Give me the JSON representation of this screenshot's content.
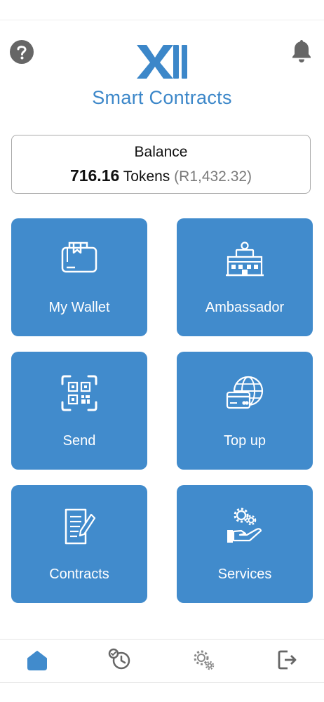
{
  "header": {
    "logo_text": "X11",
    "title": "Smart Contracts",
    "help_icon": "help-circle-icon",
    "notification_icon": "bell-icon"
  },
  "balance": {
    "label": "Balance",
    "amount": "716.16",
    "unit": "Tokens",
    "fiat": "(R1,432.32)"
  },
  "tiles": [
    {
      "label": "My Wallet",
      "icon": "wallet-icon"
    },
    {
      "label": "Ambassador",
      "icon": "building-icon"
    },
    {
      "label": "Send",
      "icon": "qr-code-icon"
    },
    {
      "label": "Top up",
      "icon": "globe-card-icon"
    },
    {
      "label": "Contracts",
      "icon": "document-pen-icon"
    },
    {
      "label": "Services",
      "icon": "gears-hand-icon"
    }
  ],
  "bottom_nav": [
    {
      "name": "home",
      "icon": "home-icon",
      "active": true
    },
    {
      "name": "history",
      "icon": "history-icon",
      "active": false
    },
    {
      "name": "settings",
      "icon": "gears-icon",
      "active": false
    },
    {
      "name": "logout",
      "icon": "logout-icon",
      "active": false
    }
  ],
  "colors": {
    "accent": "#418bcc",
    "title": "#3c87c9",
    "icon_gray": "#666666",
    "fiat_gray": "#7a7a7a"
  }
}
